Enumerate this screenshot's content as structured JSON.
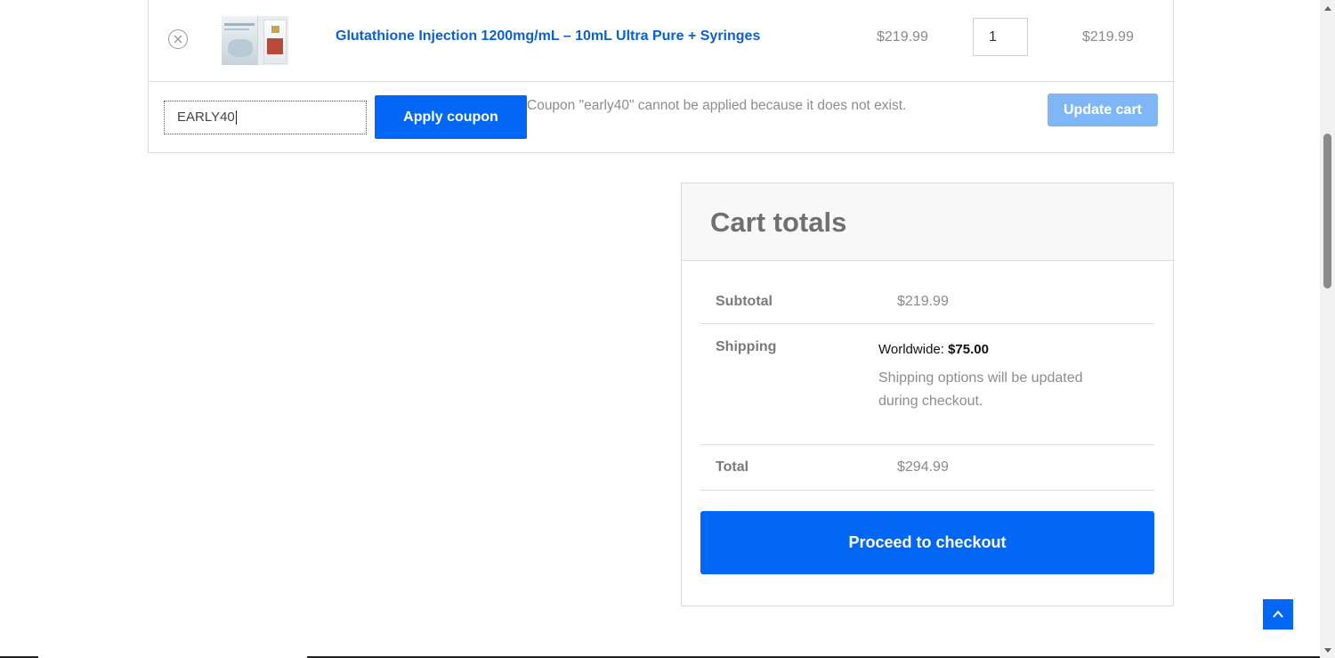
{
  "cart": {
    "item": {
      "remove_icon": "close-circle-icon",
      "product_name": "Glutathione Injection 1200mg/mL – 10mL Ultra Pure + Syringes",
      "price": "$219.99",
      "quantity": "1",
      "subtotal": "$219.99"
    },
    "coupon": {
      "value": "EARLY40",
      "apply_label": "Apply coupon",
      "message": "Coupon \"early40\" cannot be applied because it does not exist."
    },
    "update_label": "Update cart"
  },
  "totals": {
    "title": "Cart totals",
    "subtotal_label": "Subtotal",
    "subtotal_value": "$219.99",
    "shipping_label": "Shipping",
    "shipping_method": "Worldwide:",
    "shipping_amount": "$75.00",
    "shipping_note": "Shipping options will be updated during checkout.",
    "total_label": "Total",
    "total_value": "$294.99",
    "checkout_label": "Proceed to checkout"
  },
  "back_to_top_icon": "chevron-up-icon",
  "colors": {
    "primary": "#0367f5",
    "link": "#0a62d0",
    "disabled_button": "#7fb6f6"
  }
}
